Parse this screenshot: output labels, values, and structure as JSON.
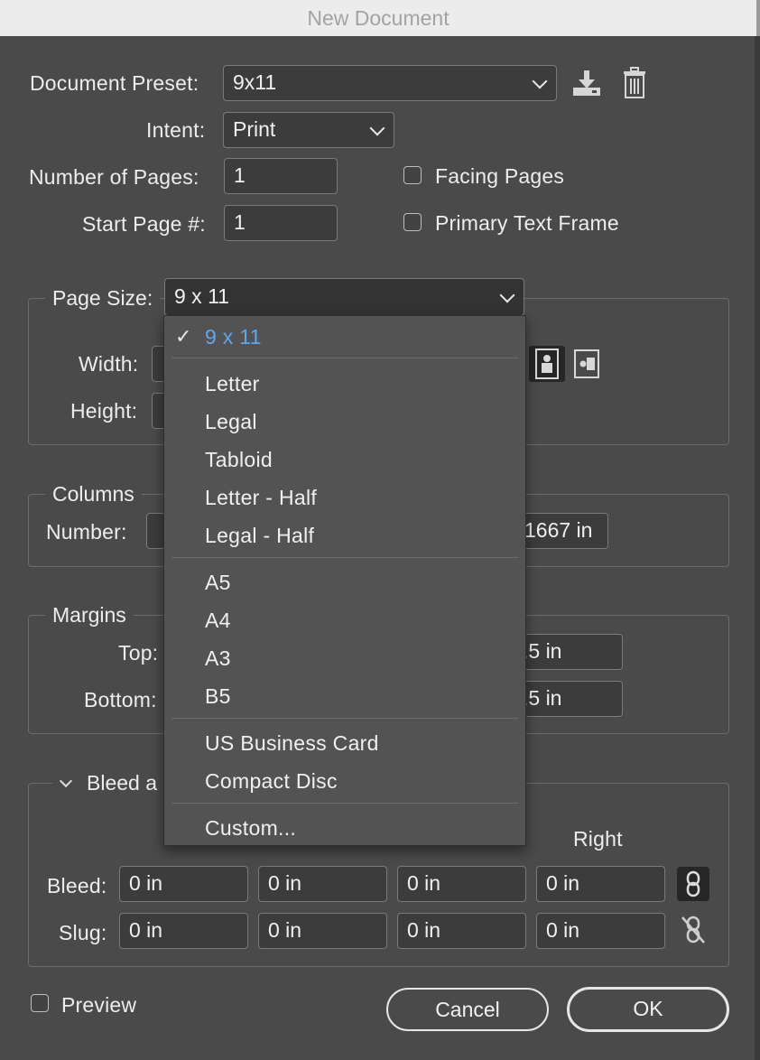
{
  "window": {
    "title": "New Document"
  },
  "preset": {
    "label": "Document Preset:",
    "value": "9x11"
  },
  "intent": {
    "label": "Intent:",
    "value": "Print"
  },
  "pages": {
    "label": "Number of Pages:",
    "value": "1"
  },
  "start_page": {
    "label": "Start Page #:",
    "value": "1"
  },
  "facing_pages": {
    "label": "Facing Pages",
    "checked": false
  },
  "primary_text_frame": {
    "label": "Primary Text Frame",
    "checked": false
  },
  "page_size": {
    "label": "Page Size:",
    "value": "9 x 11",
    "width_label": "Width:",
    "height_label": "Height:"
  },
  "columns": {
    "legend": "Columns",
    "number_label": "Number:",
    "gutter_value_fragment": "1667 in"
  },
  "margins": {
    "legend": "Margins",
    "top_label": "Top:",
    "bottom_label": "Bottom:",
    "right_top_fragment": ".5 in",
    "right_bottom_fragment": ".5 in"
  },
  "bleed": {
    "legend_fragment": "Bleed a",
    "col_right": "Right",
    "bleed_label": "Bleed:",
    "slug_label": "Slug:",
    "bleed_values": [
      "0 in",
      "0 in",
      "0 in",
      "0 in"
    ],
    "slug_values": [
      "0 in",
      "0 in",
      "0 in",
      "0 in"
    ]
  },
  "preview": {
    "label": "Preview",
    "checked": false
  },
  "buttons": {
    "cancel": "Cancel",
    "ok": "OK"
  },
  "dropdown": {
    "check": "✓",
    "items": [
      "9 x 11",
      "Letter",
      "Legal",
      "Tabloid",
      "Letter - Half",
      "Legal - Half",
      "A5",
      "A4",
      "A3",
      "B5",
      "US Business Card",
      "Compact Disc",
      "Custom..."
    ],
    "selected": "9 x 11"
  },
  "colors": {
    "background": "#4a4a4a",
    "accent": "#5aa9ef",
    "field": "#3c3c3c"
  }
}
